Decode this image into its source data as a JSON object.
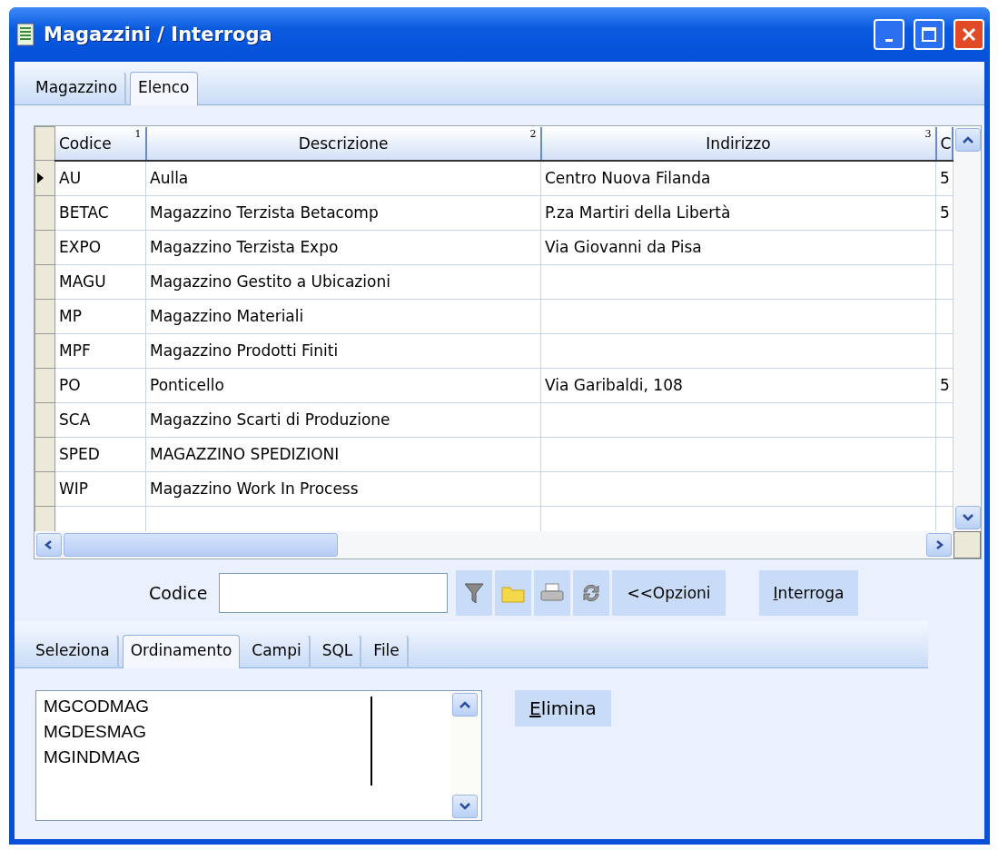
{
  "window": {
    "title": "Magazzini / Interroga"
  },
  "tabs": [
    {
      "label": "Magazzino",
      "selected": false
    },
    {
      "label": "Elenco",
      "selected": true
    }
  ],
  "table": {
    "columns": [
      {
        "label": "Codice",
        "sort": "1"
      },
      {
        "label": "Descrizione",
        "sort": "2"
      },
      {
        "label": "Indirizzo",
        "sort": "3"
      },
      {
        "label": "C"
      }
    ],
    "rows": [
      {
        "selected": true,
        "cells": [
          "AU",
          "Aulla",
          "Centro Nuova Filanda",
          "5"
        ]
      },
      {
        "selected": false,
        "cells": [
          "BETAC",
          "Magazzino Terzista Betacomp",
          "P.za Martiri della Libertà",
          "5"
        ]
      },
      {
        "selected": false,
        "cells": [
          "EXPO",
          "Magazzino Terzista Expo",
          "Via Giovanni da Pisa",
          ""
        ]
      },
      {
        "selected": false,
        "cells": [
          "MAGU",
          "Magazzino Gestito a Ubicazioni",
          "",
          ""
        ]
      },
      {
        "selected": false,
        "cells": [
          "MP",
          "Magazzino Materiali",
          "",
          ""
        ]
      },
      {
        "selected": false,
        "cells": [
          "MPF",
          "Magazzino Prodotti Finiti",
          "",
          ""
        ]
      },
      {
        "selected": false,
        "cells": [
          "PO",
          "Ponticello",
          "Via Garibaldi, 108",
          "5"
        ]
      },
      {
        "selected": false,
        "cells": [
          "SCA",
          "Magazzino Scarti di Produzione",
          "",
          ""
        ]
      },
      {
        "selected": false,
        "cells": [
          "SPED",
          "MAGAZZINO SPEDIZIONI",
          "",
          ""
        ]
      },
      {
        "selected": false,
        "cells": [
          "WIP",
          "Magazzino Work In Process",
          "",
          ""
        ]
      }
    ]
  },
  "search": {
    "label": "Codice",
    "options_button": "<<Opzioni",
    "query_button": "Interroga"
  },
  "lower_tabs": [
    {
      "label": "Seleziona",
      "selected": false
    },
    {
      "label": "Ordinamento",
      "selected": true
    },
    {
      "label": "Campi",
      "selected": false
    },
    {
      "label": "SQL",
      "selected": false
    },
    {
      "label": "File",
      "selected": false
    }
  ],
  "sort_fields": [
    "MGCODMAG",
    "MGDESMAG",
    "MGINDMAG"
  ],
  "delete_button": "Elimina"
}
